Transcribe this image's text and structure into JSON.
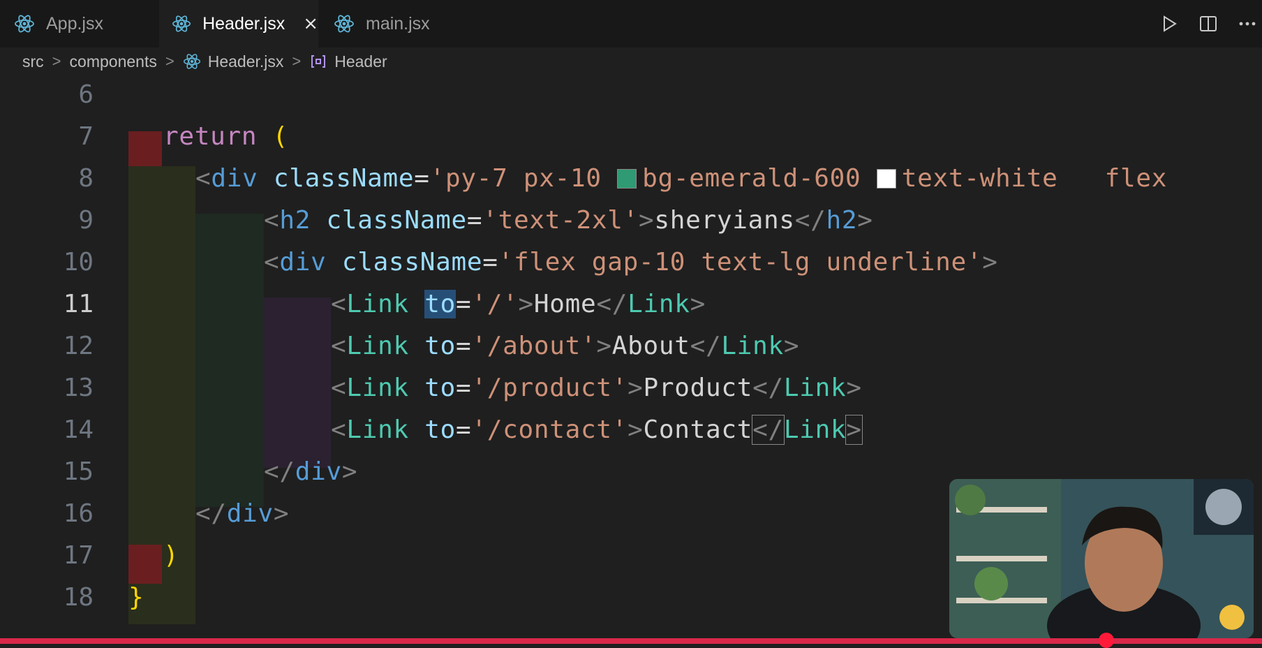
{
  "tabs": [
    {
      "label": "App.jsx",
      "active": false
    },
    {
      "label": "Header.jsx",
      "active": true,
      "close": "×"
    },
    {
      "label": "main.jsx",
      "active": false
    }
  ],
  "tabbar_actions": [
    "run-icon",
    "split-editor-icon",
    "more-icon"
  ],
  "breadcrumb": {
    "folder1": "src",
    "folder2": "components",
    "file": "Header.jsx",
    "symbol": "Header",
    "separator": ">"
  },
  "editor": {
    "line_numbers": [
      "6",
      "7",
      "8",
      "9",
      "10",
      "11",
      "12",
      "13",
      "14",
      "15",
      "16",
      "17",
      "18"
    ],
    "current_line": "11",
    "colors": {
      "emerald": "#059669",
      "white": "#ffffff"
    },
    "l7": {
      "kw": "return",
      "paren": "("
    },
    "l8": {
      "open": "<",
      "tag": "div",
      "attr": "className",
      "eq": "=",
      "s1": "'py-7 px-10 ",
      "s2": "bg-emerald-600 ",
      "s3": "text-white   flex"
    },
    "l9": {
      "open": "<",
      "tag": "h2",
      "attr": "className",
      "eq": "=",
      "str": "'text-2xl'",
      "gt": ">",
      "text": "sheryians",
      "close": "</",
      "ctag": "h2",
      "cgt": ">"
    },
    "l10": {
      "open": "<",
      "tag": "div",
      "attr": "className",
      "eq": "=",
      "str": "'flex gap-10 text-lg underline'",
      "gt": ">"
    },
    "l11": {
      "open": "<",
      "comp": "Link",
      "attr": "to",
      "eq": "=",
      "str": "'/'",
      "gt": ">",
      "text": "Home",
      "close": "</",
      "ccomp": "Link",
      "cgt": ">"
    },
    "l12": {
      "open": "<",
      "comp": "Link",
      "attr": "to",
      "eq": "=",
      "str": "'/about'",
      "gt": ">",
      "text": "About",
      "close": "</",
      "ccomp": "Link",
      "cgt": ">"
    },
    "l13": {
      "open": "<",
      "comp": "Link",
      "attr": "to",
      "eq": "=",
      "str": "'/product'",
      "gt": ">",
      "text": "Product",
      "close": "</",
      "ccomp": "Link",
      "cgt": ">"
    },
    "l14": {
      "open": "<",
      "comp": "Link",
      "attr": "to",
      "eq": "=",
      "str": "'/contact'",
      "gt": ">",
      "text": "Contact",
      "close": "</",
      "ccomp": "Link",
      "cgt": ">"
    },
    "l15": {
      "close": "</",
      "tag": "div",
      "gt": ">"
    },
    "l16": {
      "close": "</",
      "tag": "div",
      "gt": ">"
    },
    "l17": {
      "paren": ")"
    },
    "l18": {
      "brace": "}"
    }
  },
  "video": {
    "progress_percent": 88
  }
}
